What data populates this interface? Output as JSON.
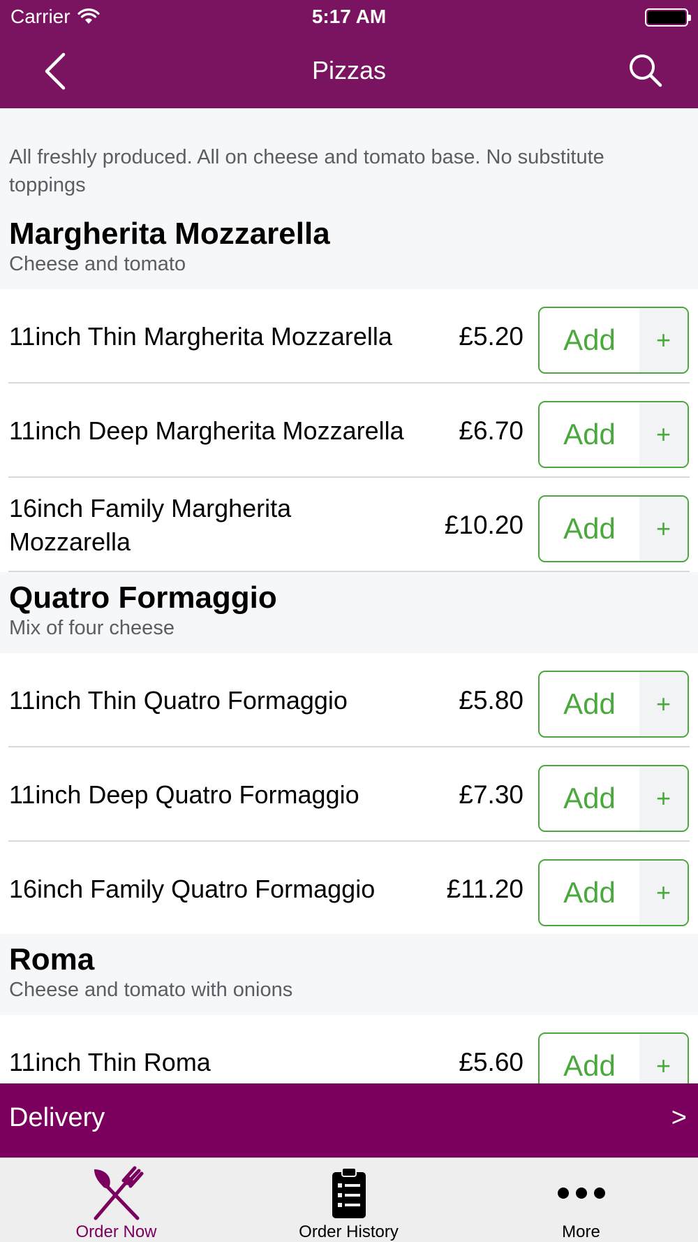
{
  "status_bar": {
    "carrier": "Carrier",
    "time": "5:17 AM"
  },
  "nav": {
    "title": "Pizzas"
  },
  "intro": "All freshly produced. All on cheese and tomato base. No substitute toppings",
  "sections": [
    {
      "name": "Margherita Mozzarella",
      "description": "Cheese and tomato",
      "items": [
        {
          "name": "11inch Thin Margherita Mozzarella",
          "price": "£5.20",
          "add_label": "Add",
          "plus_label": "+"
        },
        {
          "name": "11inch Deep Margherita Mozzarella",
          "price": "£6.70",
          "add_label": "Add",
          "plus_label": "+"
        },
        {
          "name": "16inch Family Margherita Mozzarella",
          "price": "£10.20",
          "add_label": "Add",
          "plus_label": "+"
        }
      ]
    },
    {
      "name": "Quatro Formaggio",
      "description": "Mix of four cheese",
      "items": [
        {
          "name": "11inch Thin Quatro Formaggio",
          "price": "£5.80",
          "add_label": "Add",
          "plus_label": "+"
        },
        {
          "name": "11inch Deep Quatro Formaggio",
          "price": "£7.30",
          "add_label": "Add",
          "plus_label": "+"
        },
        {
          "name": "16inch Family Quatro Formaggio",
          "price": "£11.20",
          "add_label": "Add",
          "plus_label": "+"
        }
      ]
    },
    {
      "name": "Roma",
      "description": "Cheese and tomato with onions",
      "items": [
        {
          "name": "11inch Thin Roma",
          "price": "£5.60",
          "add_label": "Add",
          "plus_label": "+"
        }
      ]
    }
  ],
  "delivery": {
    "label": "Delivery",
    "arrow": ">"
  },
  "tabs": [
    {
      "label": "Order Now",
      "icon": "fork-knife-icon",
      "active": true
    },
    {
      "label": "Order History",
      "icon": "clipboard-list-icon",
      "active": false
    },
    {
      "label": "More",
      "icon": "more-dots-icon",
      "active": false
    }
  ],
  "colors": {
    "brand": "#7a1460",
    "delivery_bar": "#7b005d",
    "add_green": "#4aa83d",
    "active_tab": "#7b005d"
  }
}
